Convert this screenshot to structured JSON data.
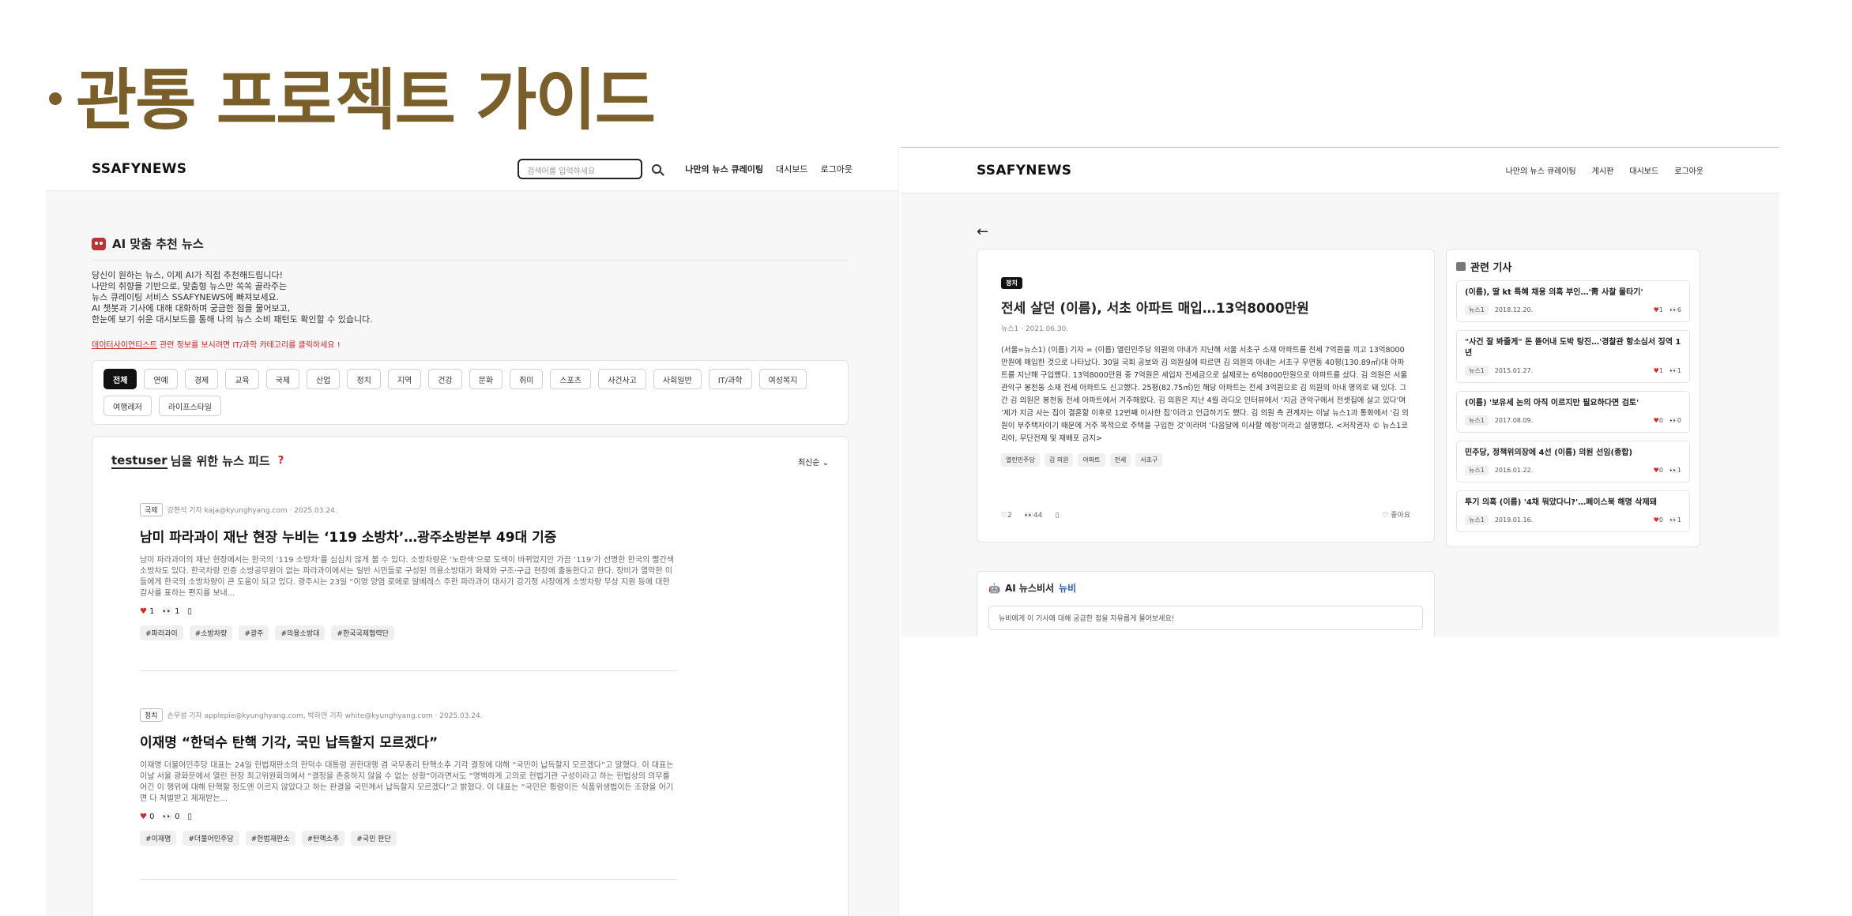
{
  "slide": {
    "title": "관통 프로젝트 가이드"
  },
  "left": {
    "brand": "SSAFYNEWS",
    "search_placeholder": "검색어를 입력하세요",
    "nav": [
      "나만의 뉴스 큐레이팅",
      "대시보드",
      "로그아웃"
    ],
    "ai_title": "AI 맞춤 추천 뉴스",
    "ai_desc": [
      "당신이 원하는 뉴스, 이제 AI가 직접 추천해드립니다!",
      "나만의 취향을 기반으로, 맞춤형 뉴스만 쏙쏙 골라주는",
      "뉴스 큐레이팅 서비스 SSAFYNEWS에 빠져보세요.",
      "AI 챗봇과 기사에 대해 대화하며 궁금한 점을 물어보고,",
      "한눈에 보기 쉬운 대시보드를 통해 나의 뉴스 소비 패턴도 확인할 수 있습니다."
    ],
    "ai_warn_link": "데이터사이언티스트",
    "ai_warn_rest": " 관련 정보를 보시려면 IT/과학 카테고리를 클릭하세요 !",
    "categories": [
      "전체",
      "연예",
      "경제",
      "교육",
      "국제",
      "산업",
      "정치",
      "지역",
      "건강",
      "문화",
      "취미",
      "스포츠",
      "사건사고",
      "사회일반",
      "IT/과학",
      "여성복지",
      "여행레저",
      "라이프스타일"
    ],
    "feed_user": "testuser",
    "feed_title": " 님을 위한 뉴스 피드",
    "feed_help": "?",
    "feed_sort": "최신순",
    "articles": [
      {
        "cat": "국제",
        "meta": "강현석 기자 kaja@kyunghyang.com · 2025.03.24.",
        "title": "남미 파라과이 재난 현장 누비는 ‘119 소방차’…광주소방본부 49대 기증",
        "body": "남미 파라과이의 재난 현장에서는 한국의 ‘119 소방차’를 심심치 않게 볼 수 있다. 소방차량은 ‘노란색’으로 도색이 바뀌었지만 가끔 ‘119’가 선명한 한국의 빨간색 소방차도 있다. 한국차랑 인증 소방공무원이 없는 파라과이에서는 일반 시민들로 구성된 의용소방대가 화재와 구조·구급 현장에 출동한다고 한다. 장비가 열악한 이들에게 한국의 소방차량이 큰 도움이 되고 있다. 광주시는 23일 “이영 양염 로에로 알베레스 주한 파라과이 대사가 강기정 시장에게 소방차량 무상 지원 등에 대한 감사를 표하는 편지를 보내...",
        "likes": "1",
        "views": "1",
        "tags": [
          "#파라과이",
          "#소방차량",
          "#광주",
          "#의용소방대",
          "#한국국제협력단"
        ]
      },
      {
        "cat": "정치",
        "meta": "손우성 기자 applepie@kyunghyang.com, 박하얀 기자 white@kyunghyang.com · 2025.03.24.",
        "title": "이재명 “한덕수 탄핵 기각, 국민 납득할지 모르겠다”",
        "body": "이재명 더불어민주당 대표는 24일 헌법재판소의 한덕수 대통령 권한대행 겸 국무총리 탄핵소추 기각 결정에 대해 “국민이 납득할지 모르겠다”고 말했다. 이 대표는 이날 서울 광화문에서 열린 현장 최고위원회의에서 “결정을 존중하지 않을 수 없는 상황”이라면서도 “명백하게 고의로 헌법기관 구성이라고 하는 헌법상의 의무를 어긴 이 행위에 대해 탄핵할 정도엔 이르지 않았다고 하는 판결을 국민께서 납득할지 모르겠다”고 밝혔다. 이 대표는 “국민은 횡령이든 식품위생법이든 조항을 어기면 다 처벌받고 제재받는...",
        "likes": "0",
        "views": "0",
        "tags": [
          "#이재명",
          "#더불어민주당",
          "#헌법재판소",
          "#탄핵소추",
          "#국민 판단"
        ]
      }
    ]
  },
  "right": {
    "brand": "SSAFYNEWS",
    "nav": [
      "나만의 뉴스 큐레이팅",
      "게시판",
      "대시보드",
      "로그아웃"
    ],
    "back": "←",
    "detail": {
      "cat": "정치",
      "title": "전세 살던 (이름), 서초 아파트 매입…13억8000만원",
      "meta": "뉴스1 · 2021.06.30.",
      "body": "(서울=뉴스1) (이름) 기자 = (이름) 열린민주당 의원의 아내가 지난해 서울 서초구 소재 아파트를 전세 7억원을 끼고 13억8000만원에 매입한 것으로 나타났다. 30일 국회 공보와 김 의원실에 따르면 김 의원의 아내는 서초구 우면동 40평(130.89㎡)대 아파트를 지난해 구입했다. 13억8000만원 중 7억원은 세입자 전세금으로 실제로는 6억8000만원으로 아파트를 샀다. 김 의원은 서울 관악구 봉천동 소재 전세 아파트도 신고했다. 25평(82.75㎡)인 해당 아파트는 전세 3억원으로 김 의원의 아내 명의로 돼 있다. 그간 김 의원은 봉천동 전세 아파트에서 거주해왔다. 김 의원은 지난 4월 라디오 인터뷰에서 ‘지금 관악구에서 전셋집에 살고 있다’며 ‘제가 지금 사는 집이 결혼할 이후로 12번째 이사한 집’이라고 언급하기도 했다. 김 의원 측 관계자는 이날 뉴스1과 통화에서 ‘김 의원이 부주택자이기 때문에 거주 목적으로 주택을 구입한 것’이라며 ‘다음달에 이사할 예정’이라고 설명했다. <저작권자 © 뉴스1코리아, 무단전재 및 재배포 금지>",
      "tags": [
        "열린민주당",
        "김 의원",
        "아파트",
        "전세",
        "서초구"
      ],
      "likes": "2",
      "views": "44",
      "like_btn": "좋아요"
    },
    "related_title": "관련 기사",
    "related": [
      {
        "title": "(이름), 딸 kt 특혜 채용 의혹 부인…'靑 사찰 몰타기'",
        "src": "뉴스1",
        "date": "2018.12.20.",
        "likes": "1",
        "views": "6"
      },
      {
        "title": "\"사건 잘 봐줄게\" 돈 뜯어내 도박 탕진…'경찰관 항소심서 징역 1년",
        "src": "뉴스1",
        "date": "2015.01.27.",
        "likes": "1",
        "views": "1"
      },
      {
        "title": "(이름) '보유세 논의 아직 이르지만 필요하다면 검토'",
        "src": "뉴스1",
        "date": "2017.08.09.",
        "likes": "0",
        "views": "0"
      },
      {
        "title": "민주당, 정책위의장에 4선 (이름) 의원 선임(종합)",
        "src": "뉴스1",
        "date": "2016.01.22.",
        "likes": "0",
        "views": "1"
      },
      {
        "title": "투기 의혹 (이름) '4채 뭐았다니?'…페이스북 해명 삭제돼",
        "src": "뉴스1",
        "date": "2019.01.16.",
        "likes": "0",
        "views": "1"
      }
    ],
    "chat_title_a": "AI 뉴스비서",
    "chat_title_b": "뉴비",
    "chat_prompt": "뉴비에게 이 기사에 대해 궁금한 점을 자유롭게 물어보세요!"
  }
}
